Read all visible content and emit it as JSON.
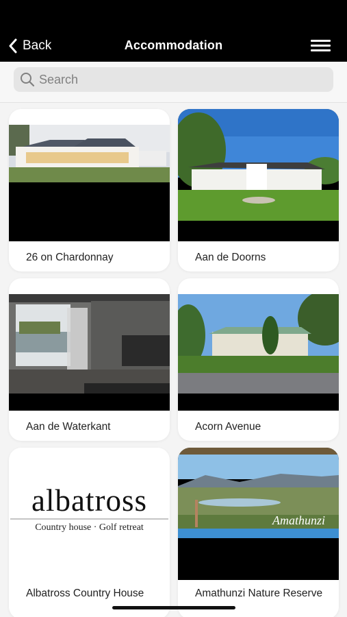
{
  "nav": {
    "back_label": "Back",
    "title": "Accommodation"
  },
  "search": {
    "placeholder": "Search"
  },
  "listings": [
    {
      "name": "26 on Chardonnay"
    },
    {
      "name": "Aan de Doorns"
    },
    {
      "name": "Aan de Waterkant"
    },
    {
      "name": "Acorn Avenue"
    },
    {
      "name": "Albatross Country House",
      "logo_word": "albatross",
      "logo_tagline": "Country house · Golf retreat"
    },
    {
      "name": "Amathunzi Nature Reserve",
      "logo_word": "Amathunzi"
    }
  ],
  "colors": {
    "nav_bg": "#000000",
    "page_bg": "#f4f4f4",
    "card_bg": "#ffffff",
    "search_bg": "#e5e5e5"
  },
  "icons": {
    "back": "chevron-left-icon",
    "menu": "hamburger-menu-icon",
    "search": "magnifier-icon"
  }
}
